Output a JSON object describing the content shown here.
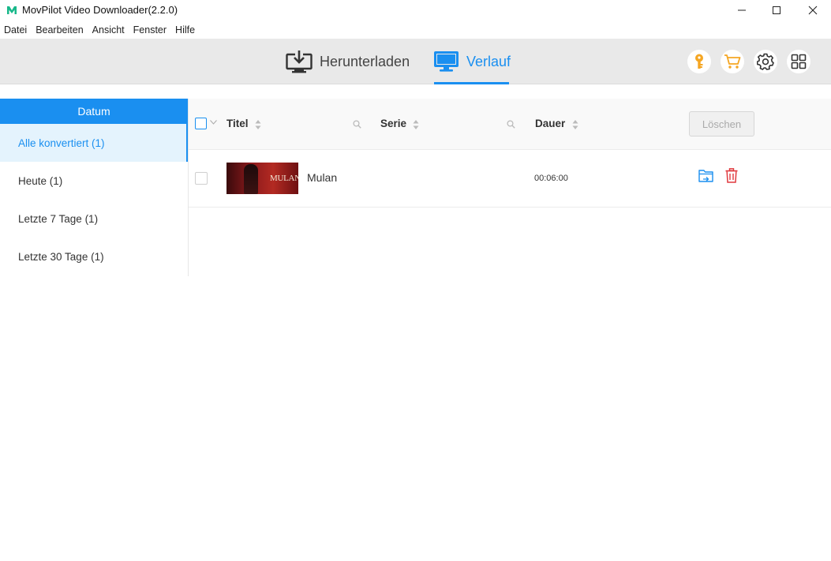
{
  "window": {
    "title": "MovPilot Video Downloader(2.2.0)"
  },
  "menu": {
    "items": [
      "Datei",
      "Bearbeiten",
      "Ansicht",
      "Fenster",
      "Hilfe"
    ]
  },
  "nav": {
    "download_label": "Herunterladen",
    "history_label": "Verlauf",
    "active": "history"
  },
  "toolbar": {
    "icons": [
      "key-icon",
      "cart-icon",
      "gear-icon",
      "grid-icon"
    ]
  },
  "sidebar": {
    "header": "Datum",
    "items": [
      {
        "label": "Alle konvertiert (1)",
        "active": true
      },
      {
        "label": "Heute (1)",
        "active": false
      },
      {
        "label": "Letzte 7 Tage (1)",
        "active": false
      },
      {
        "label": "Letzte 30 Tage (1)",
        "active": false
      }
    ]
  },
  "table": {
    "columns": {
      "title": "Titel",
      "series": "Serie",
      "duration": "Dauer"
    },
    "delete_label": "Löschen",
    "rows": [
      {
        "thumbnail_text": "MULAN",
        "title": "Mulan",
        "series": "",
        "duration": "00:06:00"
      }
    ]
  },
  "colors": {
    "accent": "#1a8ff0",
    "toolbar_bg": "#e9e9e9",
    "delete_red": "#e0393e",
    "key_orange": "#f5a623"
  }
}
